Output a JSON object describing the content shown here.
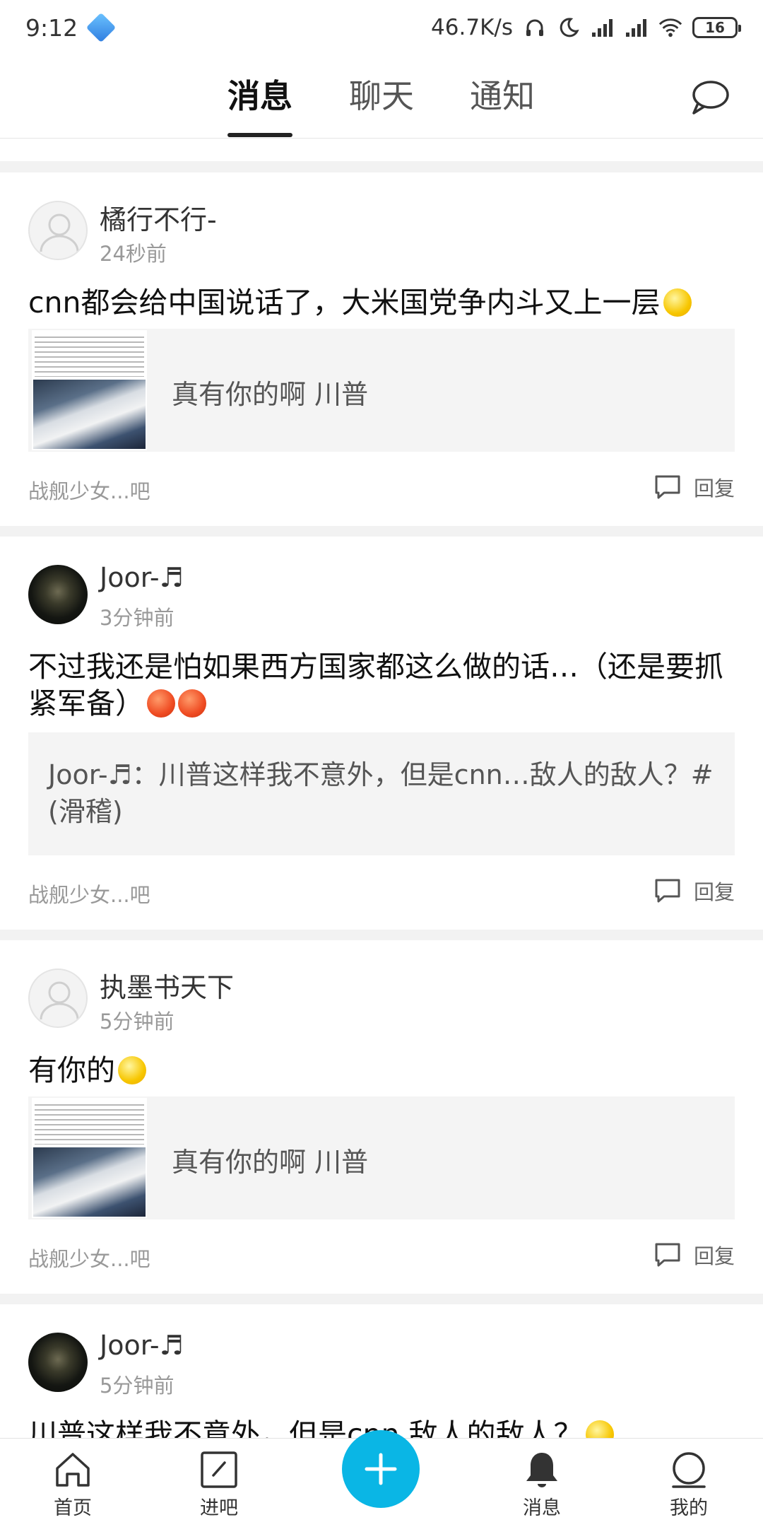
{
  "status_bar": {
    "time": "9:12",
    "net_speed": "46.7K/s",
    "battery": "16"
  },
  "tabs": [
    {
      "label": "消息",
      "active": true
    },
    {
      "label": "聊天",
      "active": false
    },
    {
      "label": "通知",
      "active": false
    }
  ],
  "feed": [
    {
      "user": "橘行不行-",
      "time": "24秒前",
      "content": "cnn都会给中国说话了，大米国党争内斗又上一层",
      "quote": "真有你的啊  川普",
      "forum": "战舰少女...吧",
      "reply": "回复"
    },
    {
      "user": "Joor-♬",
      "time": "3分钟前",
      "content": "不过我还是怕如果西方国家都这么做的话…（还是要抓紧军备）",
      "quote": "Joor-♬：川普这样我不意外，但是cnn…敌人的敌人？#(滑稽)",
      "forum": "战舰少女...吧",
      "reply": "回复"
    },
    {
      "user": "执墨书天下",
      "time": "5分钟前",
      "content": "有你的",
      "quote": "真有你的啊  川普",
      "forum": "战舰少女...吧",
      "reply": "回复"
    },
    {
      "user": "Joor-♬",
      "time": "5分钟前",
      "content": "川普这样我不意外，但是cnn  敌人的敌人？"
    }
  ],
  "bottom_nav": [
    {
      "label": "首页",
      "icon": "home-icon"
    },
    {
      "label": "进吧",
      "icon": "enter-forum-icon"
    },
    {
      "label": "",
      "icon": "plus-icon"
    },
    {
      "label": "消息",
      "icon": "bell-icon"
    },
    {
      "label": "我的",
      "icon": "profile-icon"
    }
  ],
  "colors": {
    "accent": "#0ab6e5",
    "divider": "#f2f2f2"
  }
}
